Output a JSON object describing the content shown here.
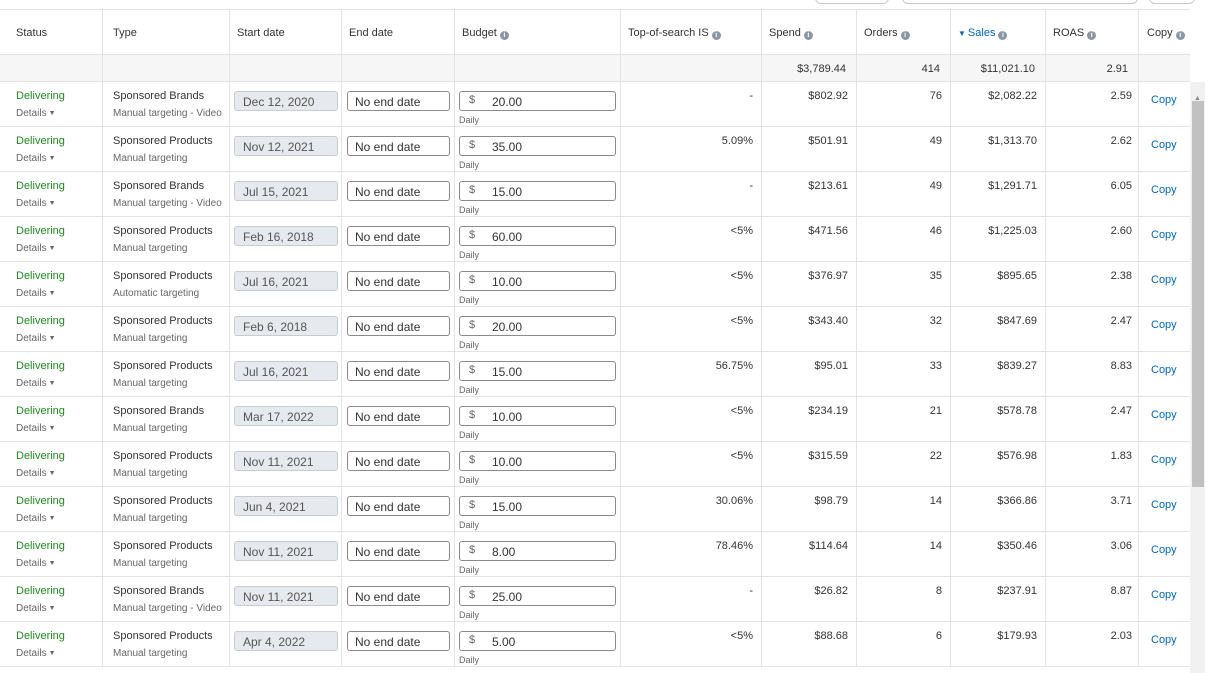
{
  "columns": {
    "status": "Status",
    "type": "Type",
    "start_date": "Start date",
    "end_date": "End date",
    "budget": "Budget",
    "top_of_search": "Top-of-search IS",
    "spend": "Spend",
    "orders": "Orders",
    "sales": "Sales",
    "roas": "ROAS",
    "copy": "Copy"
  },
  "totals": {
    "spend": "$3,789.44",
    "orders": "414",
    "sales": "$11,021.10",
    "roas": "2.91"
  },
  "rows": [
    {
      "status": "Delivering",
      "details": "Details",
      "type": "Sponsored Brands",
      "targeting": "Manual targeting - Video",
      "start": "Dec 12, 2020",
      "end": "No end date",
      "currency": "$",
      "budget": "20.00",
      "period": "Daily",
      "tos": "-",
      "spend": "$802.92",
      "orders": "76",
      "sales": "$2,082.22",
      "roas": "2.59",
      "copy": "Copy"
    },
    {
      "status": "Delivering",
      "details": "Details",
      "type": "Sponsored Products",
      "targeting": "Manual targeting",
      "start": "Nov 12, 2021",
      "end": "No end date",
      "currency": "$",
      "budget": "35.00",
      "period": "Daily",
      "tos": "5.09%",
      "spend": "$501.91",
      "orders": "49",
      "sales": "$1,313.70",
      "roas": "2.62",
      "copy": "Copy"
    },
    {
      "status": "Delivering",
      "details": "Details",
      "type": "Sponsored Brands",
      "targeting": "Manual targeting - Video",
      "start": "Jul 15, 2021",
      "end": "No end date",
      "currency": "$",
      "budget": "15.00",
      "period": "Daily",
      "tos": "-",
      "spend": "$213.61",
      "orders": "49",
      "sales": "$1,291.71",
      "roas": "6.05",
      "copy": "Copy"
    },
    {
      "status": "Delivering",
      "details": "Details",
      "type": "Sponsored Products",
      "targeting": "Manual targeting",
      "start": "Feb 16, 2018",
      "end": "No end date",
      "currency": "$",
      "budget": "60.00",
      "period": "Daily",
      "tos": "<5%",
      "spend": "$471.56",
      "orders": "46",
      "sales": "$1,225.03",
      "roas": "2.60",
      "copy": "Copy"
    },
    {
      "status": "Delivering",
      "details": "Details",
      "type": "Sponsored Products",
      "targeting": "Automatic targeting",
      "start": "Jul 16, 2021",
      "end": "No end date",
      "currency": "$",
      "budget": "10.00",
      "period": "Daily",
      "tos": "<5%",
      "spend": "$376.97",
      "orders": "35",
      "sales": "$895.65",
      "roas": "2.38",
      "copy": "Copy"
    },
    {
      "status": "Delivering",
      "details": "Details",
      "type": "Sponsored Products",
      "targeting": "Manual targeting",
      "start": "Feb 6, 2018",
      "end": "No end date",
      "currency": "$",
      "budget": "20.00",
      "period": "Daily",
      "tos": "<5%",
      "spend": "$343.40",
      "orders": "32",
      "sales": "$847.69",
      "roas": "2.47",
      "copy": "Copy"
    },
    {
      "status": "Delivering",
      "details": "Details",
      "type": "Sponsored Products",
      "targeting": "Manual targeting",
      "start": "Jul 16, 2021",
      "end": "No end date",
      "currency": "$",
      "budget": "15.00",
      "period": "Daily",
      "tos": "56.75%",
      "spend": "$95.01",
      "orders": "33",
      "sales": "$839.27",
      "roas": "8.83",
      "copy": "Copy"
    },
    {
      "status": "Delivering",
      "details": "Details",
      "type": "Sponsored Brands",
      "targeting": "Manual targeting",
      "start": "Mar 17, 2022",
      "end": "No end date",
      "currency": "$",
      "budget": "10.00",
      "period": "Daily",
      "tos": "<5%",
      "spend": "$234.19",
      "orders": "21",
      "sales": "$578.78",
      "roas": "2.47",
      "copy": "Copy"
    },
    {
      "status": "Delivering",
      "details": "Details",
      "type": "Sponsored Products",
      "targeting": "Manual targeting",
      "start": "Nov 11, 2021",
      "end": "No end date",
      "currency": "$",
      "budget": "10.00",
      "period": "Daily",
      "tos": "<5%",
      "spend": "$315.59",
      "orders": "22",
      "sales": "$576.98",
      "roas": "1.83",
      "copy": "Copy"
    },
    {
      "status": "Delivering",
      "details": "Details",
      "type": "Sponsored Products",
      "targeting": "Manual targeting",
      "start": "Jun 4, 2021",
      "end": "No end date",
      "currency": "$",
      "budget": "15.00",
      "period": "Daily",
      "tos": "30.06%",
      "spend": "$98.79",
      "orders": "14",
      "sales": "$366.86",
      "roas": "3.71",
      "copy": "Copy"
    },
    {
      "status": "Delivering",
      "details": "Details",
      "type": "Sponsored Products",
      "targeting": "Manual targeting",
      "start": "Nov 11, 2021",
      "end": "No end date",
      "currency": "$",
      "budget": "8.00",
      "period": "Daily",
      "tos": "78.46%",
      "spend": "$114.64",
      "orders": "14",
      "sales": "$350.46",
      "roas": "3.06",
      "copy": "Copy"
    },
    {
      "status": "Delivering",
      "details": "Details",
      "type": "Sponsored Brands",
      "targeting": "Manual targeting - Video",
      "start": "Nov 11, 2021",
      "end": "No end date",
      "currency": "$",
      "budget": "25.00",
      "period": "Daily",
      "tos": "-",
      "spend": "$26.82",
      "orders": "8",
      "sales": "$237.91",
      "roas": "8.87",
      "copy": "Copy"
    },
    {
      "status": "Delivering",
      "details": "Details",
      "type": "Sponsored Products",
      "targeting": "Manual targeting",
      "start": "Apr 4, 2022",
      "end": "No end date",
      "currency": "$",
      "budget": "5.00",
      "period": "Daily",
      "tos": "<5%",
      "spend": "$88.68",
      "orders": "6",
      "sales": "$179.93",
      "roas": "2.03",
      "copy": "Copy"
    }
  ],
  "colors": {
    "delivering": "#1f8a1f",
    "link": "#0066c0",
    "info_icon": "#8a96a3"
  },
  "icons": {
    "info": "info-icon",
    "sort_desc": "sort-descending-icon",
    "caret": "chevron-down-icon",
    "scroll_up": "scroll-up-arrow-icon"
  }
}
